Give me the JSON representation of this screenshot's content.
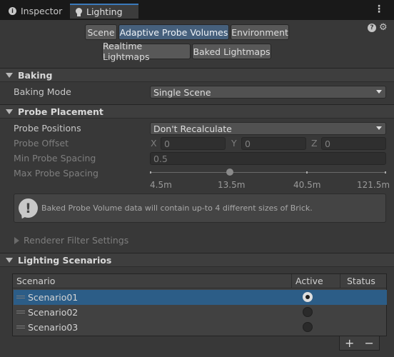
{
  "tabs": [
    {
      "label": "Inspector",
      "icon": "info-icon",
      "active": false
    },
    {
      "label": "Lighting",
      "icon": "lightbulb-icon",
      "active": true
    }
  ],
  "toolbar": {
    "row1": [
      "Scene",
      "Adaptive Probe Volumes",
      "Environment"
    ],
    "row2": [
      "Realtime Lightmaps",
      "Baked Lightmaps"
    ],
    "selected": "Adaptive Probe Volumes"
  },
  "baking": {
    "header": "Baking",
    "mode_label": "Baking Mode",
    "mode_value": "Single Scene"
  },
  "probe_placement": {
    "header": "Probe Placement",
    "positions_label": "Probe Positions",
    "positions_value": "Don't Recalculate",
    "offset_label": "Probe Offset",
    "offset": {
      "x_label": "X",
      "x": "0",
      "y_label": "Y",
      "y": "0",
      "z_label": "Z",
      "z": "0"
    },
    "min_spacing_label": "Min Probe Spacing",
    "min_spacing_value": "0.5",
    "max_spacing_label": "Max Probe Spacing",
    "max_spacing_ticks": [
      "4.5m",
      "13.5m",
      "40.5m",
      "121.5m"
    ],
    "max_spacing_value": "13.5m",
    "help_text": "Baked Probe Volume data will contain up-to 4 different sizes of Brick.",
    "renderer_filter": "Renderer Filter Settings"
  },
  "scenarios": {
    "header": "Lighting Scenarios",
    "columns": [
      "Scenario",
      "Active",
      "Status"
    ],
    "rows": [
      {
        "name": "Scenario01",
        "active": true
      },
      {
        "name": "Scenario02",
        "active": false
      },
      {
        "name": "Scenario03",
        "active": false
      }
    ],
    "add_label": "+",
    "remove_label": "−"
  },
  "colors": {
    "accent": "#2c5d87",
    "tab_accent": "#3a79bb",
    "selected_button": "#46607c"
  }
}
